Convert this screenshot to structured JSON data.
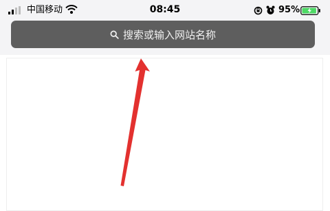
{
  "status_bar": {
    "carrier": "中国移动",
    "time": "08:45",
    "battery_percent": "95%",
    "battery_color": "#4cd964"
  },
  "search": {
    "placeholder": "搜索或输入网站名称",
    "bar_color": "#5e5e5e"
  },
  "annotation": {
    "arrow_color": "#e3312f"
  }
}
